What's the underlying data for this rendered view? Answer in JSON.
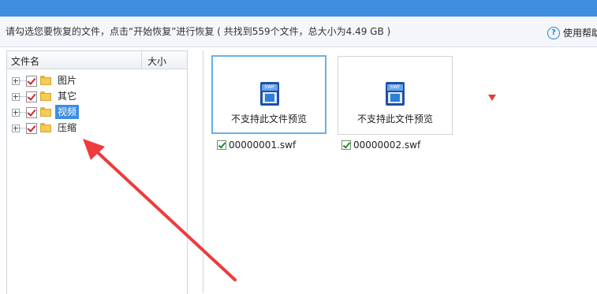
{
  "colors": {
    "header_blue": "#3f8ee0",
    "selection": "#3c8ee0",
    "arrow_red": "#ee3b3b",
    "card_selected_border": "#6ab0ea"
  },
  "info_bar": {
    "text": "请勾选您要恢复的文件，点击“开始恢复”进行恢复 ( 共找到559个文件，总大小为4.49 GB )"
  },
  "help": {
    "icon": "question-circle-icon",
    "label": "使用帮助"
  },
  "tree": {
    "columns": {
      "name": "文件名",
      "size": "大小"
    },
    "items": [
      {
        "label": "图片",
        "checked": true,
        "selected": false
      },
      {
        "label": "其它",
        "checked": true,
        "selected": false
      },
      {
        "label": "视频",
        "checked": true,
        "selected": true
      },
      {
        "label": "压缩",
        "checked": true,
        "selected": false
      }
    ]
  },
  "files": [
    {
      "name": "00000001.swf",
      "preview_text": "不支持此文件预览",
      "checked": true,
      "selected": true,
      "icon": "swf-file-icon",
      "icon_tag": "SWF"
    },
    {
      "name": "00000002.swf",
      "preview_text": "不支持此文件预览",
      "checked": true,
      "selected": false,
      "icon": "swf-file-icon",
      "icon_tag": "SWF"
    }
  ]
}
